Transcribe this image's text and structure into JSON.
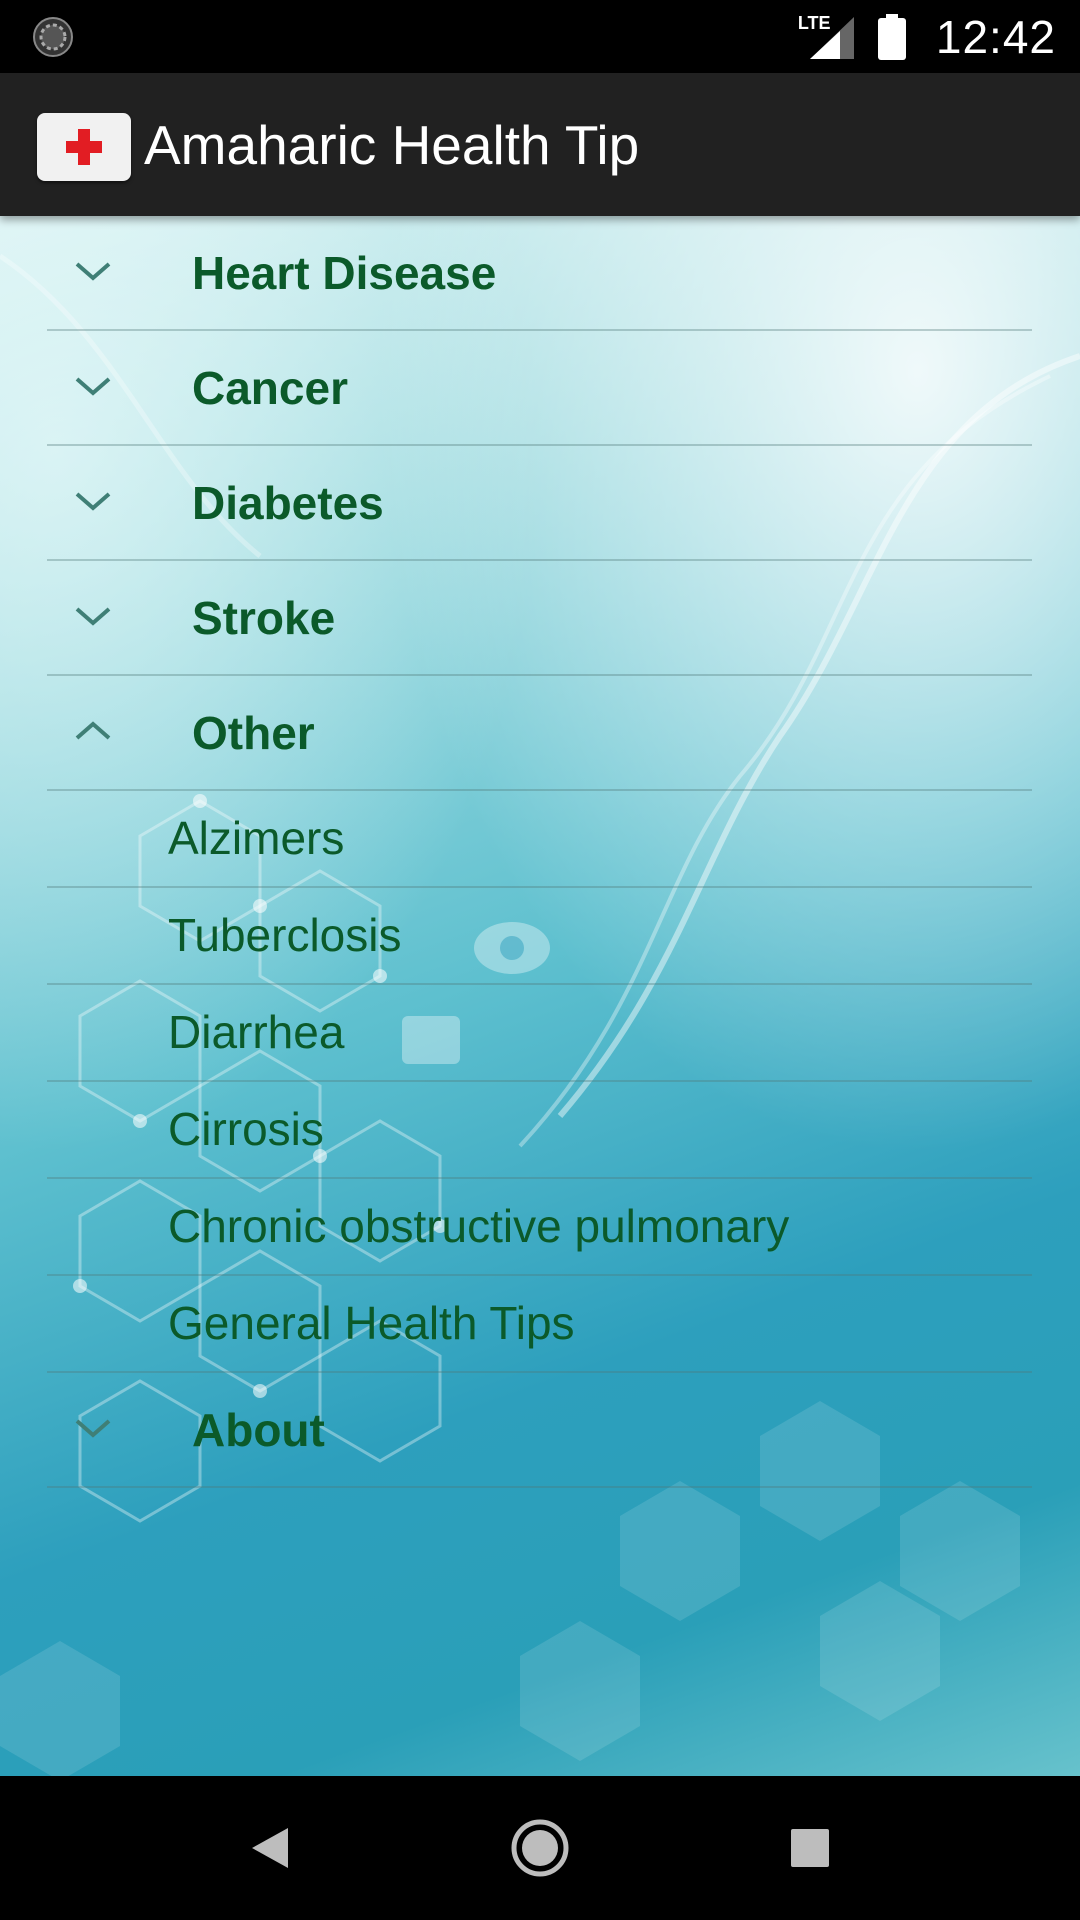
{
  "status_bar": {
    "network": "LTE",
    "time": "12:42"
  },
  "app_bar": {
    "title": "Amaharic Health Tip",
    "icon": "red-cross-icon"
  },
  "menu": {
    "groups": [
      {
        "label": "Heart Disease",
        "expanded": false
      },
      {
        "label": "Cancer",
        "expanded": false
      },
      {
        "label": "Diabetes",
        "expanded": false
      },
      {
        "label": "Stroke",
        "expanded": false
      },
      {
        "label": "Other",
        "expanded": true,
        "children": [
          "Alzimers",
          "Tuberclosis",
          "Diarrhea",
          "Cirrosis",
          "Chronic obstructive pulmonary",
          "General Health Tips"
        ]
      },
      {
        "label": "About",
        "expanded": false
      }
    ]
  },
  "nav_bar": {
    "back": "back-icon",
    "home": "home-icon",
    "recents": "recents-icon"
  },
  "colors": {
    "label_green": "#0b5a2a",
    "app_bar": "#212121",
    "cross_red": "#e21d23"
  }
}
